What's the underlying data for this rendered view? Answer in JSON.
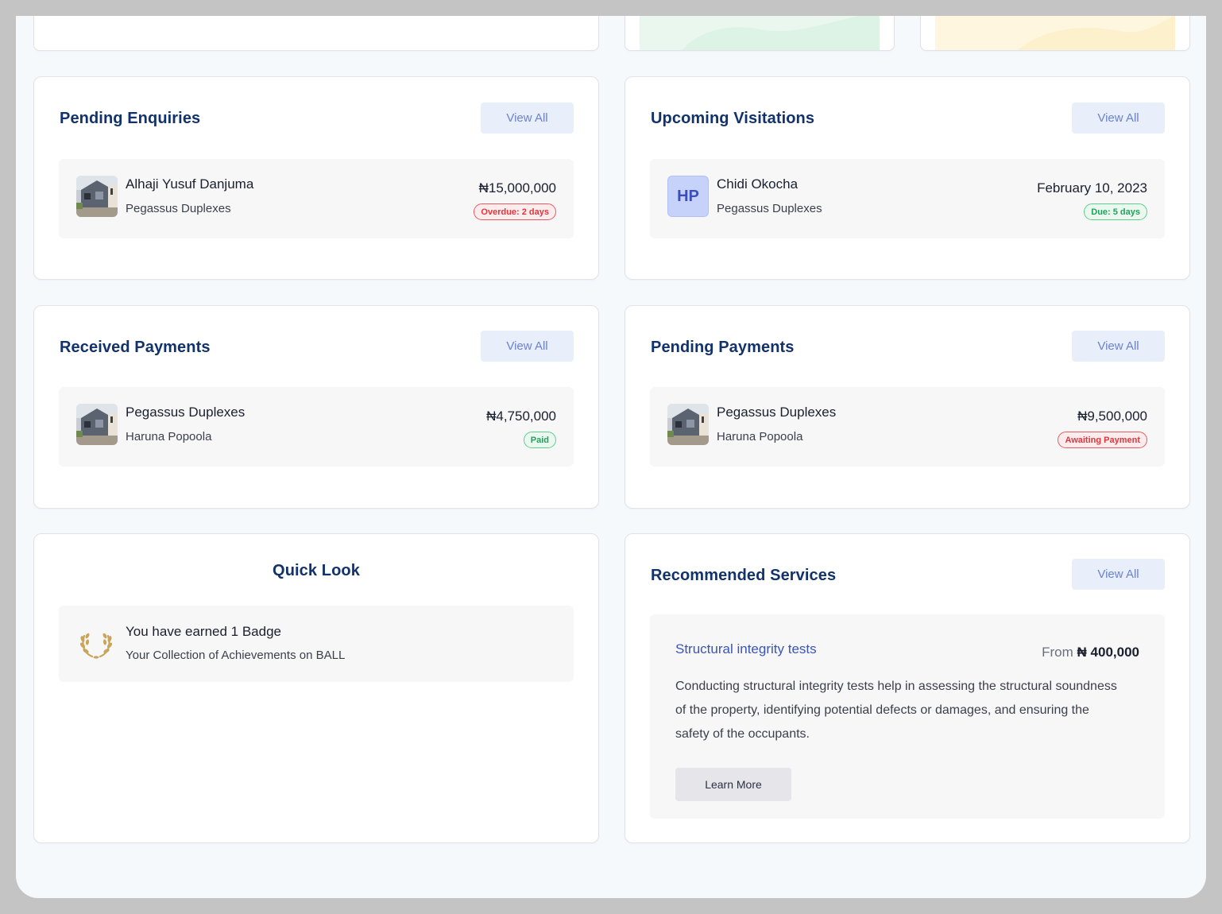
{
  "colors": {
    "title": "#12326b",
    "view_all_bg": "#e9eefb",
    "view_all_text": "#6b82cf",
    "danger": "#e2343f",
    "success": "#20a25a",
    "service_title": "#3a55b5"
  },
  "pending_enquiries": {
    "title": "Pending Enquiries",
    "view_all": "View All",
    "items": [
      {
        "name": "Alhaji Yusuf Danjuma",
        "property": "Pegassus Duplexes",
        "amount": "₦15,000,000",
        "badge": "Overdue: 2 days",
        "badge_status": "danger",
        "icon": "house-thumbnail"
      }
    ]
  },
  "upcoming_visitations": {
    "title": "Upcoming Visitations",
    "view_all": "View All",
    "items": [
      {
        "initials": "HP",
        "name": "Chidi Okocha",
        "property": "Pegassus Duplexes",
        "date": "February 10, 2023",
        "badge": "Due: 5 days",
        "badge_status": "success"
      }
    ]
  },
  "received_payments": {
    "title": "Received Payments",
    "view_all": "View All",
    "items": [
      {
        "property": "Pegassus Duplexes",
        "payer": "Haruna Popoola",
        "amount": "₦4,750,000",
        "badge": "Paid",
        "badge_status": "success",
        "icon": "house-thumbnail"
      }
    ]
  },
  "pending_payments": {
    "title": "Pending Payments",
    "view_all": "View All",
    "items": [
      {
        "property": "Pegassus Duplexes",
        "payer": "Haruna Popoola",
        "amount": "₦9,500,000",
        "badge": "Awaiting Payment",
        "badge_status": "danger",
        "icon": "house-thumbnail"
      }
    ]
  },
  "quick_look": {
    "title": "Quick Look",
    "badge_title": "You have earned 1 Badge",
    "badge_sub": "Your Collection of Achievements on BALL",
    "icon": "laurel-wreath-icon"
  },
  "recommended_services": {
    "title": "Recommended Services",
    "view_all": "View All",
    "service": {
      "name": "Structural integrity tests",
      "price_prefix": "From",
      "price": "₦ 400,000",
      "description": "Conducting structural integrity tests help in assessing the structural soundness of the property, identifying potential defects or damages, and ensuring the safety of the occupants.",
      "button": "Learn More"
    }
  }
}
